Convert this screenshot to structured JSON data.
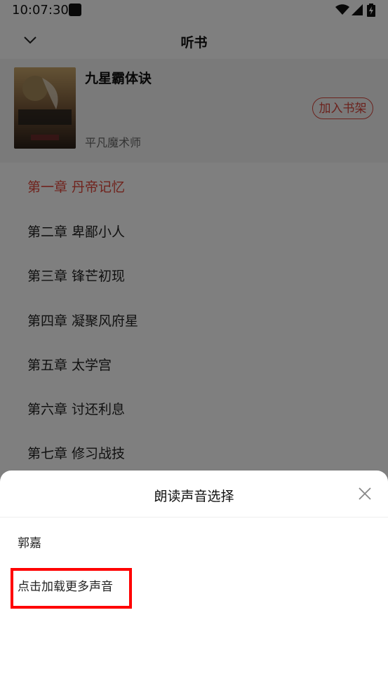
{
  "status_bar": {
    "time": "10:07:30"
  },
  "header": {
    "title": "听书"
  },
  "book": {
    "title": "九星霸体诀",
    "author": "平凡魔术师",
    "add_button": "加入书架",
    "cover_text": "九星霸体诀"
  },
  "chapters": [
    {
      "label": "第一章 丹帝记忆",
      "active": true
    },
    {
      "label": "第二章 卑鄙小人"
    },
    {
      "label": "第三章 锋芒初现"
    },
    {
      "label": "第四章 凝聚风府星"
    },
    {
      "label": "第五章 太学宫"
    },
    {
      "label": "第六章 讨还利息"
    },
    {
      "label": "第七章 修习战技"
    }
  ],
  "sheet": {
    "title": "朗读声音选择",
    "voice_option": "郭嘉",
    "load_more": "点击加载更多声音"
  },
  "colors": {
    "accent": "#e0473a",
    "highlight": "#ff0000"
  }
}
